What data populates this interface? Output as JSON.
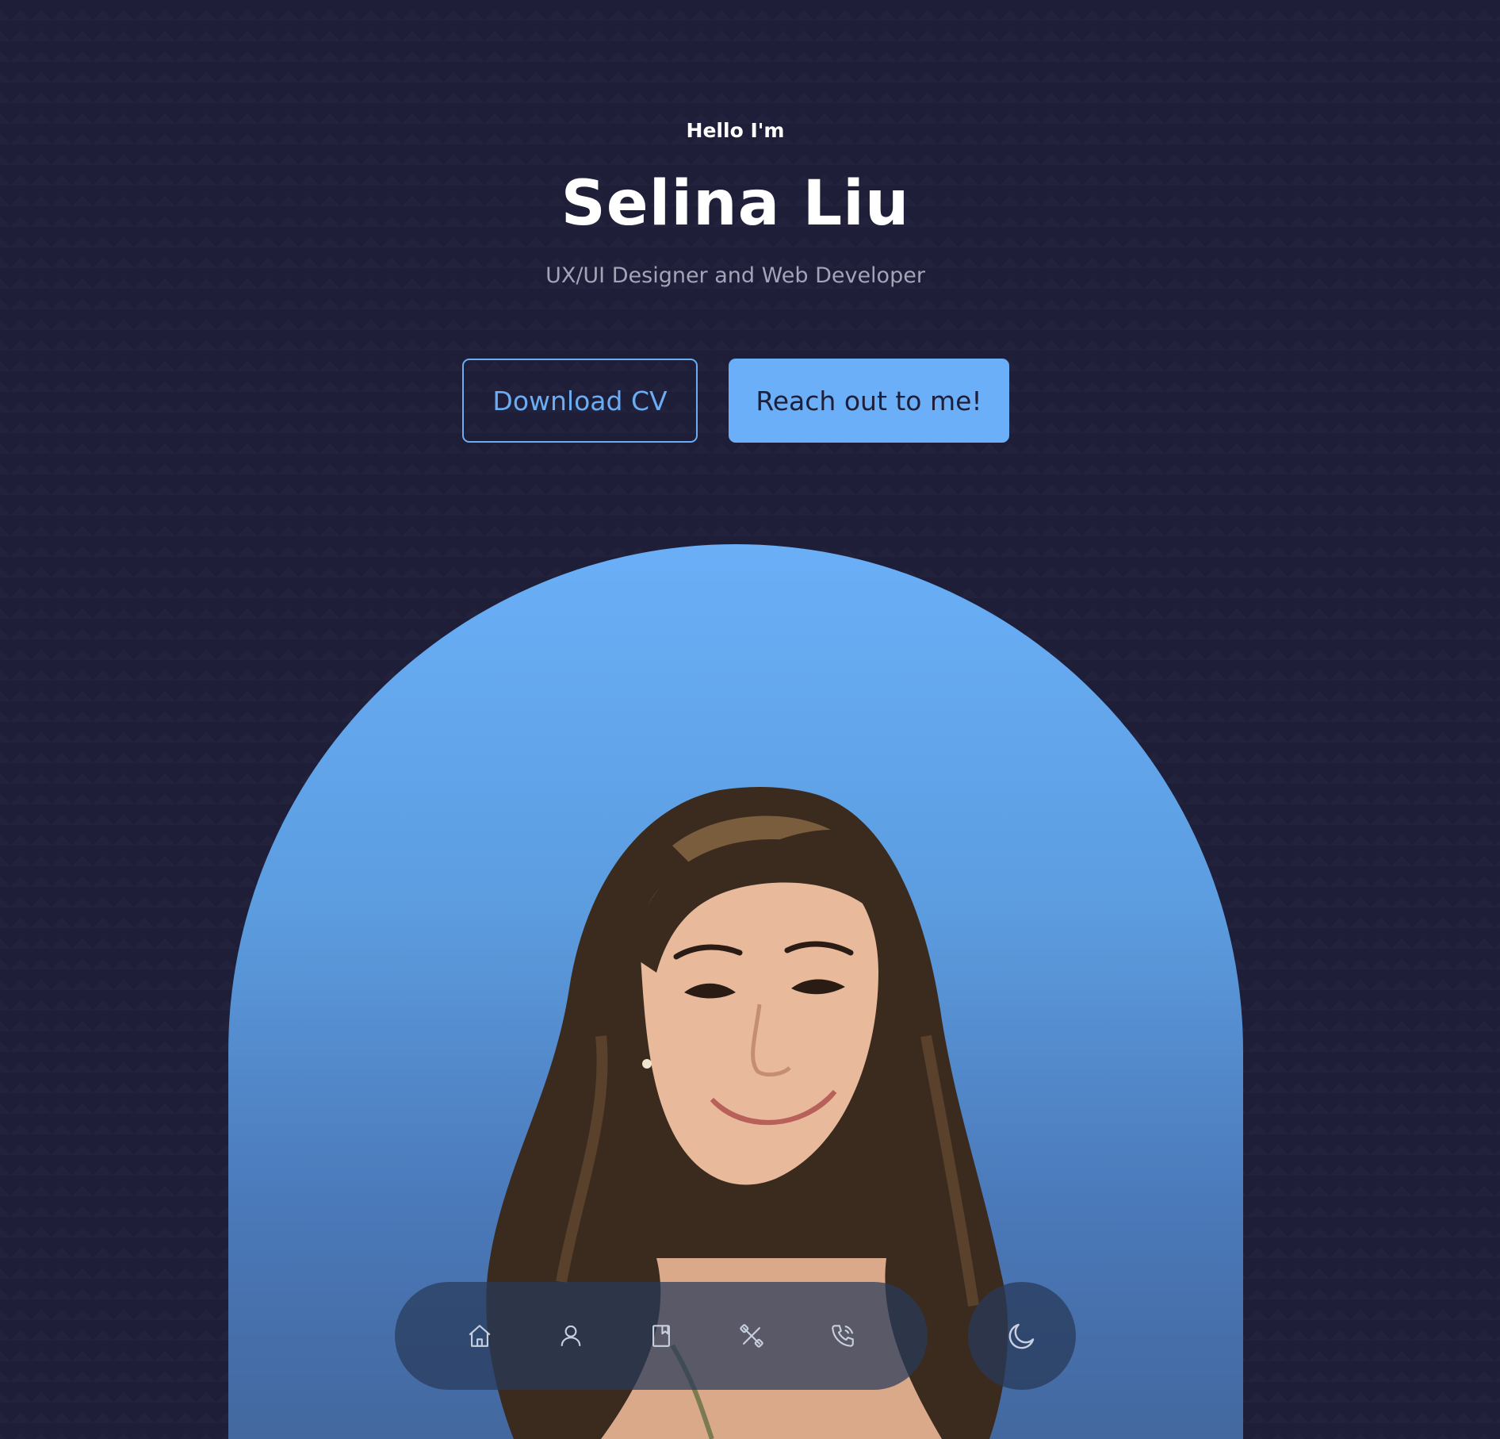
{
  "hero": {
    "greeting": "Hello I'm",
    "name": "Selina Liu",
    "role": "UX/UI Designer and Web Developer"
  },
  "buttons": {
    "download_cv": "Download CV",
    "reach_out": "Reach out to me!"
  },
  "portrait": {
    "alt": "Portrait of Selina Liu"
  },
  "dock": {
    "items": [
      {
        "icon": "home-icon"
      },
      {
        "icon": "user-icon"
      },
      {
        "icon": "book-icon"
      },
      {
        "icon": "tools-icon"
      },
      {
        "icon": "phone-icon"
      }
    ]
  },
  "theme": {
    "icon": "moon-icon"
  },
  "colors": {
    "background": "#1e1e38",
    "accent": "#6aaff7",
    "muted_text": "#a4a4b8"
  }
}
